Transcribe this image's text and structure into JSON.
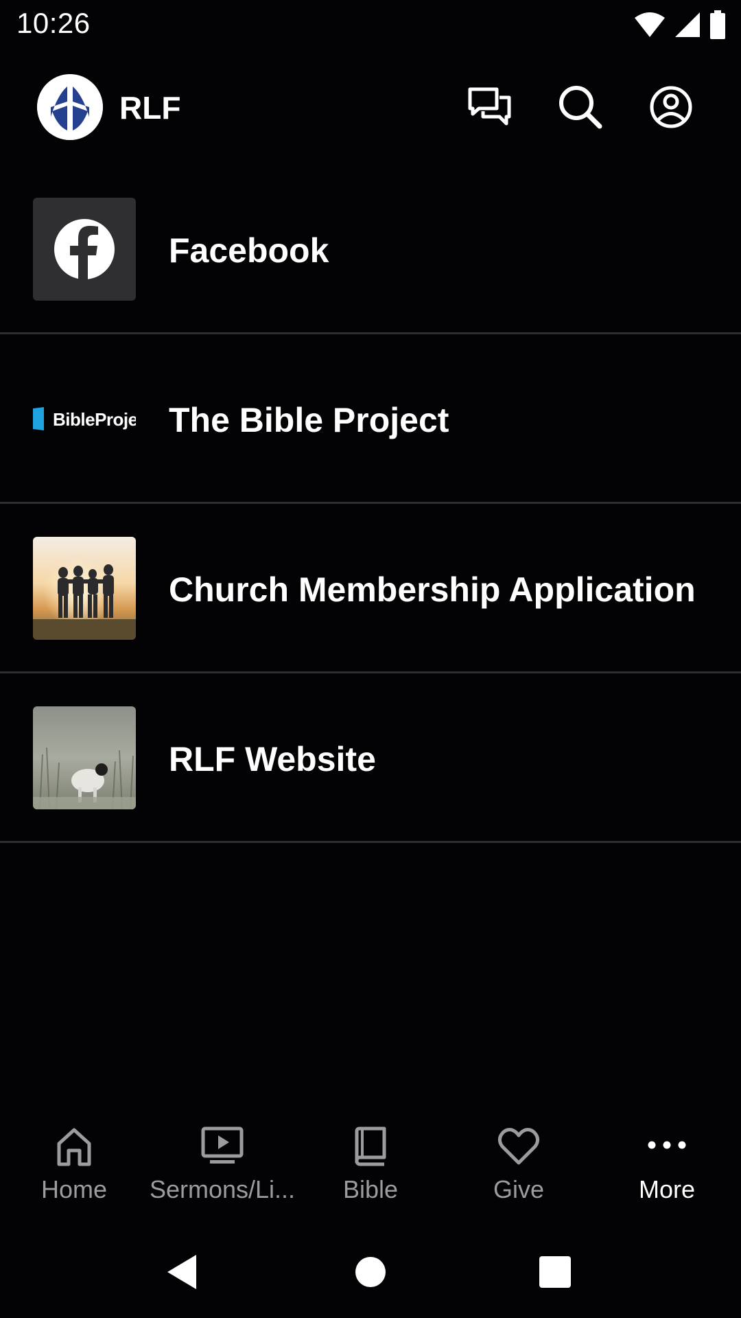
{
  "status_bar": {
    "time": "10:26"
  },
  "app_bar": {
    "title": "RLF",
    "icons": [
      "chat-icon",
      "search-icon",
      "account-icon"
    ]
  },
  "links": [
    {
      "label": "Facebook",
      "thumbnail": "facebook-logo"
    },
    {
      "label": "The Bible Project",
      "thumbnail": "bibleproject-logo",
      "thumbnail_text": "BibleProje"
    },
    {
      "label": "Church Membership Application",
      "thumbnail": "group-sunset-photo"
    },
    {
      "label": "RLF Website",
      "thumbnail": "lamb-in-field-photo"
    }
  ],
  "bottom_nav": {
    "items": [
      {
        "label": "Home",
        "icon": "home-icon",
        "active": false
      },
      {
        "label": "Sermons/Li...",
        "icon": "video-icon",
        "active": false
      },
      {
        "label": "Bible",
        "icon": "book-icon",
        "active": false
      },
      {
        "label": "Give",
        "icon": "heart-icon",
        "active": false
      },
      {
        "label": "More",
        "icon": "more-icon",
        "active": true
      }
    ]
  },
  "colors": {
    "background": "#030204",
    "divider": "#2e2e32",
    "inactive_nav": "#9c9c9f",
    "active_nav": "#ffffff",
    "logo_blue": "#24408e",
    "bibleproject_blue": "#1fa3e0"
  }
}
